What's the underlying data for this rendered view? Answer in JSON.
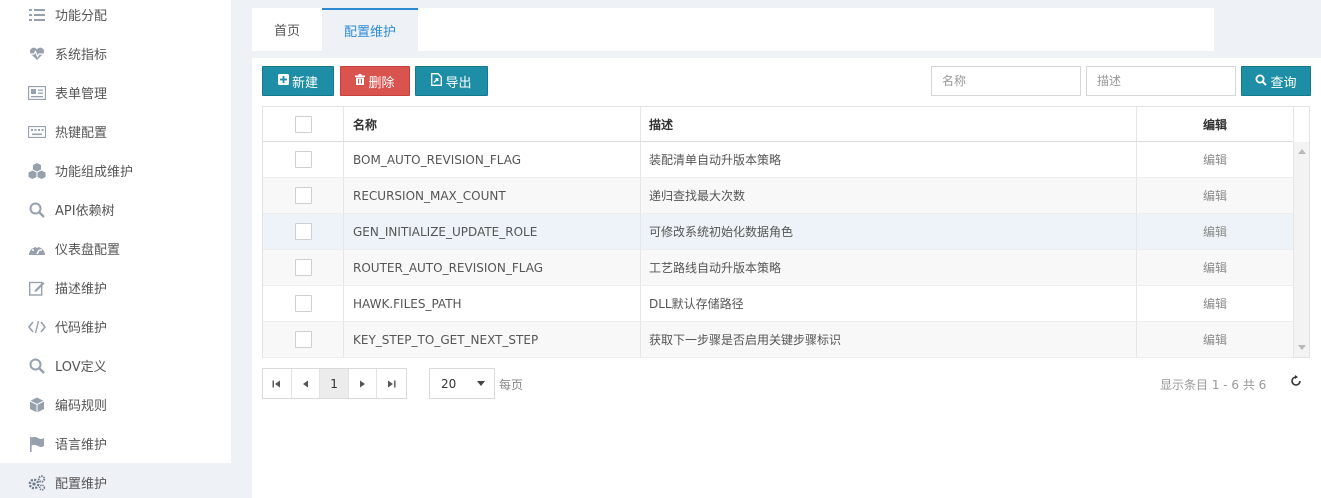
{
  "sidebar": {
    "items": [
      {
        "label": "功能分配",
        "icon": "list-icon"
      },
      {
        "label": "系统指标",
        "icon": "heartbeat-icon"
      },
      {
        "label": "表单管理",
        "icon": "id-card-icon"
      },
      {
        "label": "热键配置",
        "icon": "keyboard-icon"
      },
      {
        "label": "功能组成维护",
        "icon": "cubes-icon"
      },
      {
        "label": "API依赖树",
        "icon": "search-icon"
      },
      {
        "label": "仪表盘配置",
        "icon": "dashboard-icon"
      },
      {
        "label": "描述维护",
        "icon": "edit-icon"
      },
      {
        "label": "代码维护",
        "icon": "code-icon"
      },
      {
        "label": "LOV定义",
        "icon": "search-icon"
      },
      {
        "label": "编码规则",
        "icon": "cube-icon"
      },
      {
        "label": "语言维护",
        "icon": "flag-icon"
      },
      {
        "label": "配置维护",
        "icon": "cogs-icon"
      }
    ],
    "active": "配置维护"
  },
  "tabs": [
    {
      "label": "首页"
    },
    {
      "label": "配置维护"
    }
  ],
  "toolbar": {
    "new_label": "新建",
    "delete_label": "删除",
    "export_label": "导出",
    "query_label": "查询",
    "name_placeholder": "名称",
    "desc_placeholder": "描述"
  },
  "grid": {
    "columns": {
      "name": "名称",
      "desc": "描述",
      "edit": "编辑"
    },
    "rows": [
      {
        "name": "BOM_AUTO_REVISION_FLAG",
        "desc": "装配清单自动升版本策略",
        "edit": "编辑"
      },
      {
        "name": "RECURSION_MAX_COUNT",
        "desc": "递归查找最大次数",
        "edit": "编辑"
      },
      {
        "name": "GEN_INITIALIZE_UPDATE_ROLE",
        "desc": "可修改系统初始化数据角色",
        "edit": "编辑"
      },
      {
        "name": "ROUTER_AUTO_REVISION_FLAG",
        "desc": "工艺路线自动升版本策略",
        "edit": "编辑"
      },
      {
        "name": "HAWK.FILES_PATH",
        "desc": "DLL默认存储路径",
        "edit": "编辑"
      },
      {
        "name": "KEY_STEP_TO_GET_NEXT_STEP",
        "desc": "获取下一步骤是否启用关键步骤标识",
        "edit": "编辑"
      }
    ]
  },
  "pager": {
    "current_page": "1",
    "page_size": "20",
    "per_page_label": "每页",
    "info": "显示条目 1 - 6 共 6"
  }
}
